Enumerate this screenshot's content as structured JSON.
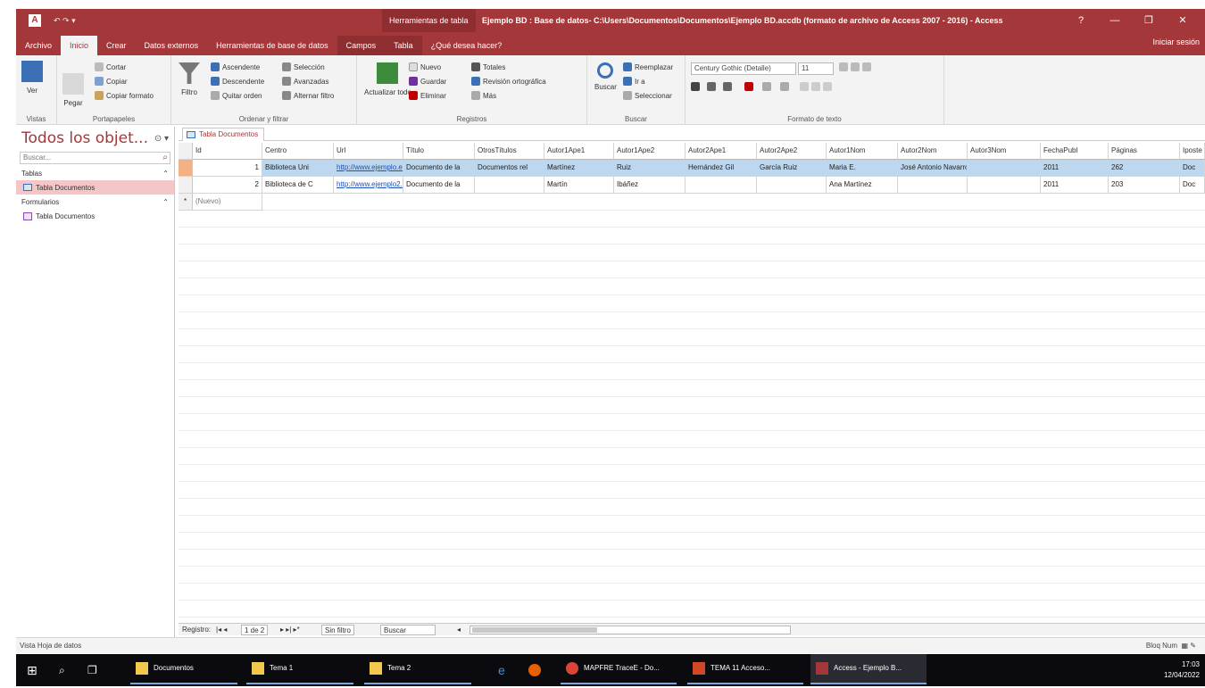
{
  "titlebar": {
    "app_icon": "A",
    "qat": "↶ ↷ ▾",
    "context_label": "Herramientas de tabla",
    "doc_title": "Ejemplo BD : Base de datos- C:\\Users\\Documentos\\Documentos\\Ejemplo BD.accdb (formato de archivo de Access 2007 - 2016) - Access",
    "win_buttons": [
      "?",
      "—",
      "❐",
      "✕"
    ]
  },
  "tabs": [
    "Archivo",
    "Inicio",
    "Crear",
    "Datos externos",
    "Herramientas de base de datos",
    "Campos",
    "Tabla",
    "¿Qué desea hacer?"
  ],
  "active_tab": "Inicio",
  "user": "Iniciar sesión",
  "ribbon": {
    "groups": [
      {
        "label": "Vistas",
        "items": [
          "Ver"
        ]
      },
      {
        "label": "Portapapeles",
        "items": [
          "Cortar",
          "Copiar",
          "Copiar formato",
          "Pegar"
        ]
      },
      {
        "label": "Ordenar y filtrar",
        "items": [
          "Ascendente",
          "Descendente",
          "Quitar orden",
          "Filtro",
          "Selección",
          "Avanzadas",
          "Alternar filtro"
        ]
      },
      {
        "label": "Registros",
        "items": [
          "Actualizar todo",
          "Nuevo",
          "Guardar",
          "Eliminar",
          "Totales",
          "Revisión ortográfica",
          "Más"
        ]
      },
      {
        "label": "Buscar",
        "items": [
          "Buscar",
          "Reemplazar",
          "Ir a",
          "Seleccionar"
        ]
      },
      {
        "label": "Formato de texto",
        "items": [
          "Century Gothic (Detalle)",
          "11"
        ]
      }
    ]
  },
  "nav": {
    "title": "Todos los objet...",
    "header_icons": "⊙ ▾",
    "search_placeholder": "Buscar...",
    "sections": [
      {
        "label": "Tablas",
        "chevron": "⌃",
        "items": [
          {
            "label": "Tabla Documentos",
            "selected": true
          }
        ]
      },
      {
        "label": "Formularios",
        "chevron": "⌃",
        "items": [
          {
            "label": "Tabla Documentos",
            "selected": false
          }
        ]
      }
    ]
  },
  "document_tab": "Tabla Documentos",
  "table": {
    "columns": [
      "Id",
      "Centro",
      "Url",
      "Título",
      "OtrosTítulos",
      "Autor1Ape1",
      "Autor1Ape2",
      "Autor2Ape1",
      "Autor2Ape2",
      "Autor1Nom",
      "Autor2Nom",
      "Autor3Nom",
      "FechaPubl",
      "Páginas",
      "Iposte"
    ],
    "rows": [
      [
        "1",
        "Biblioteca Uni",
        "http://www.ejemplo.es/",
        "Documento de la",
        "Documentos rel",
        "Martínez",
        "Ruiz",
        "Hernández Gil",
        "García Ruiz",
        "",
        "Maria E.",
        "José Antonio Navarro",
        "2011",
        "262",
        "Doc"
      ],
      [
        "2",
        "Biblioteca de C",
        "http://www.ejemplo2.es/",
        "Documento de la",
        "",
        "Martín",
        "Ibáñez",
        "",
        "",
        "",
        "Ana Martínez",
        "",
        "2011",
        "203",
        "Doc"
      ]
    ],
    "new_row_label": "(Nuevo)"
  },
  "recnav": {
    "label": "Registro:",
    "position": "1 de 2",
    "filter": "Sin filtro",
    "search": "Buscar"
  },
  "status": {
    "left": "Vista Hoja de datos",
    "right": "Bloq Num"
  },
  "taskbar": {
    "apps": [
      "Documentos",
      "Tema 1",
      "Tema 2",
      "MAPFRE TraceE - Do...",
      "TEMA 11 Acceso...",
      "Access - Ejemplo B..."
    ],
    "time": "17:03",
    "date": "12/04/2022"
  }
}
